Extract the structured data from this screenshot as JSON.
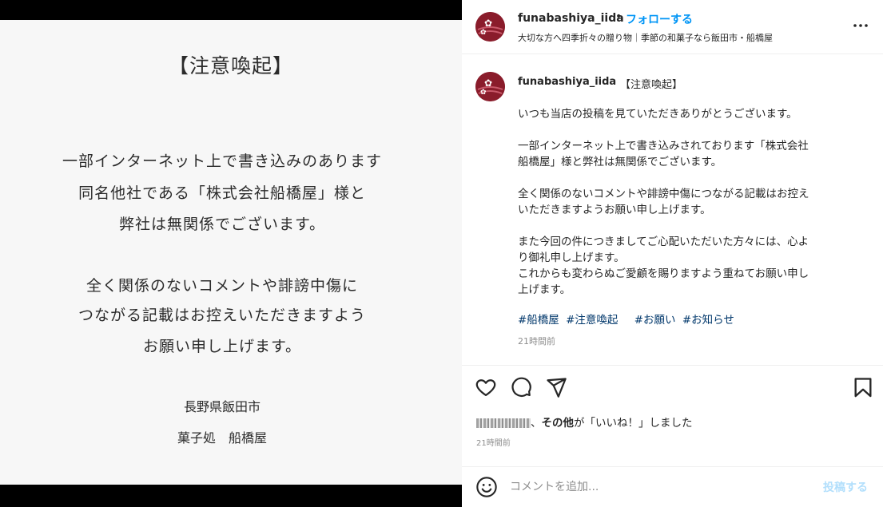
{
  "image": {
    "title": "【注意喚起】",
    "lines1": [
      "一部インターネット上で書き込みのあります",
      "同名他社である「株式会社船橋屋」様と",
      "弊社は無関係でございます。"
    ],
    "lines2": [
      "全く関係のないコメントや誹謗中傷に",
      "つながる記載はお控えいただきますよう",
      "お願い申し上げます。"
    ],
    "location": "長野県飯田市",
    "shop": "菓子処　船橋屋"
  },
  "header": {
    "username": "funabashiya_iida",
    "dot": "•",
    "follow_label": "フォローする",
    "subtitle": "大切な方へ四季折々の贈り物｜季節の和菓子なら飯田市・船橋屋"
  },
  "caption": {
    "username": "funabashiya_iida",
    "title": "【注意喚起】",
    "paragraphs": [
      "いつも当店の投稿を見ていただきありがとうございます。",
      "一部インターネット上で書き込みされております「株式会社\n船橋屋」様と弊社は無関係でございます。",
      "全く関係のないコメントや誹謗中傷につながる記載はお控え\nいただきますようお願い申し上げます。",
      "また今回の件につきましてご心配いただいた方々には、心よ\nり御礼申し上げます。\nこれからも変わらぬご愛顧を賜りますよう重ねてお願い申し\n上げます。"
    ],
    "tags": [
      "#船橋屋",
      "#注意喚起",
      "#お願い",
      "#お知らせ"
    ],
    "time": "21時間前"
  },
  "likes": {
    "others": "その他",
    "suffix": "が「いいね！」しました"
  },
  "time2": "21時間前",
  "comment": {
    "placeholder": "コメントを追加...",
    "post_label": "投稿する"
  },
  "icons": [
    "heart-icon",
    "comment-icon",
    "share-icon",
    "bookmark-icon",
    "more-icon",
    "emoji-icon"
  ],
  "colors": {
    "accent": "#0095f6",
    "post_disabled": "#b2dffc",
    "tag": "#00376b",
    "avatar": "#8a1c2b"
  }
}
